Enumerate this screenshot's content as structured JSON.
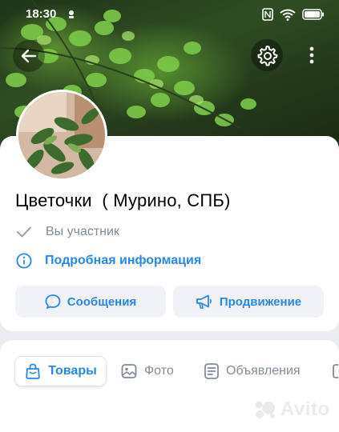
{
  "status_bar": {
    "time": "18:30",
    "icons": [
      "nfc-icon",
      "wifi-icon",
      "battery-icon"
    ]
  },
  "header": {
    "back_icon": "arrow-left-icon",
    "settings_icon": "gear-icon",
    "more_icon": "more-vertical-icon"
  },
  "group": {
    "name": "Цветочки  ( Мурино, СПБ)",
    "membership_status": "Вы участник",
    "details_link": "Подробная информация"
  },
  "actions": {
    "messages_label": "Сообщения",
    "promote_label": "Продвижение"
  },
  "tabs": [
    {
      "label": "Товары",
      "icon": "shopping-bag-icon",
      "active": true
    },
    {
      "label": "Фото",
      "icon": "photo-icon",
      "active": false
    },
    {
      "label": "Объявления",
      "icon": "ads-icon",
      "active": false
    }
  ],
  "watermark": {
    "text": "Avito"
  },
  "colors": {
    "accent": "#2688eb",
    "secondary_text": "#818c99",
    "button_bg": "#f0f2f5",
    "page_bg": "#ebedf0"
  }
}
